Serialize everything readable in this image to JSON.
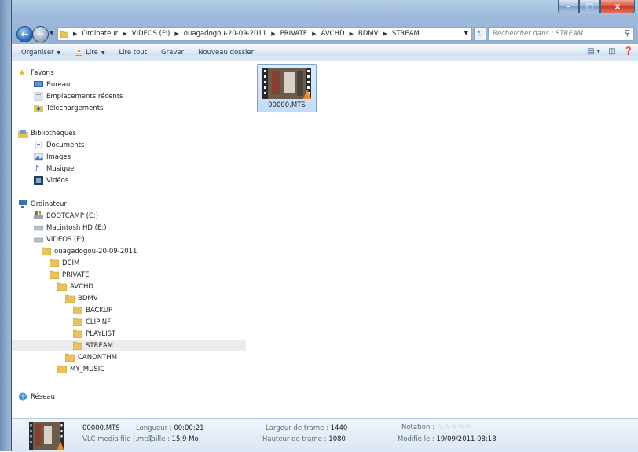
{
  "window": {
    "controls": {
      "minimize": "–",
      "maximize": "□",
      "close": "x"
    }
  },
  "address": {
    "crumbs": [
      "Ordinateur",
      "VIDEOS (F:)",
      "ouagadogou-20-09-2011",
      "PRIVATE",
      "AVCHD",
      "BDMV",
      "STREAM"
    ],
    "search_placeholder": "Rechercher dans : STREAM"
  },
  "toolbar": {
    "organize": "Organiser",
    "play": "Lire",
    "play_all": "Lire tout",
    "burn": "Graver",
    "new_folder": "Nouveau dossier"
  },
  "nav": {
    "favorites": "Favoris",
    "desktop": "Bureau",
    "recent": "Emplacements récents",
    "downloads": "Téléchargements",
    "libraries": "Bibliothèques",
    "documents": "Documents",
    "images": "Images",
    "music": "Musique",
    "videos": "Vidéos",
    "computer": "Ordinateur",
    "drive_c": "BOOTCAMP (C:)",
    "drive_e": "Macintosh HD (E:)",
    "drive_f": "VIDEOS (F:)",
    "f_root": "ouagadogou-20-09-2011",
    "dcim": "DCIM",
    "private": "PRIVATE",
    "avchd": "AVCHD",
    "bdmv": "BDMV",
    "backup": "BACKUP",
    "clipinf": "CLIPINF",
    "playlist": "PLAYLIST",
    "stream": "STREAM",
    "canonthm": "CANONTHM",
    "my_music": "MY_MUSIC",
    "network": "Réseau"
  },
  "content": {
    "file_name": "00000.MTS"
  },
  "details": {
    "file_name": "00000.MTS",
    "file_type": "VLC media file (.mts)",
    "length_label": "Longueur :",
    "length_value": "00:00:21",
    "size_label": "Taille :",
    "size_value": "15,9 Mo",
    "frame_width_label": "Largeur de trame :",
    "frame_width_value": "1440",
    "frame_height_label": "Hauteur de trame :",
    "frame_height_value": "1080",
    "rating_label": "Notation :",
    "rating_stars": "☆☆☆☆☆",
    "modified_label": "Modifié le :",
    "modified_value": "19/09/2011 08:18"
  }
}
